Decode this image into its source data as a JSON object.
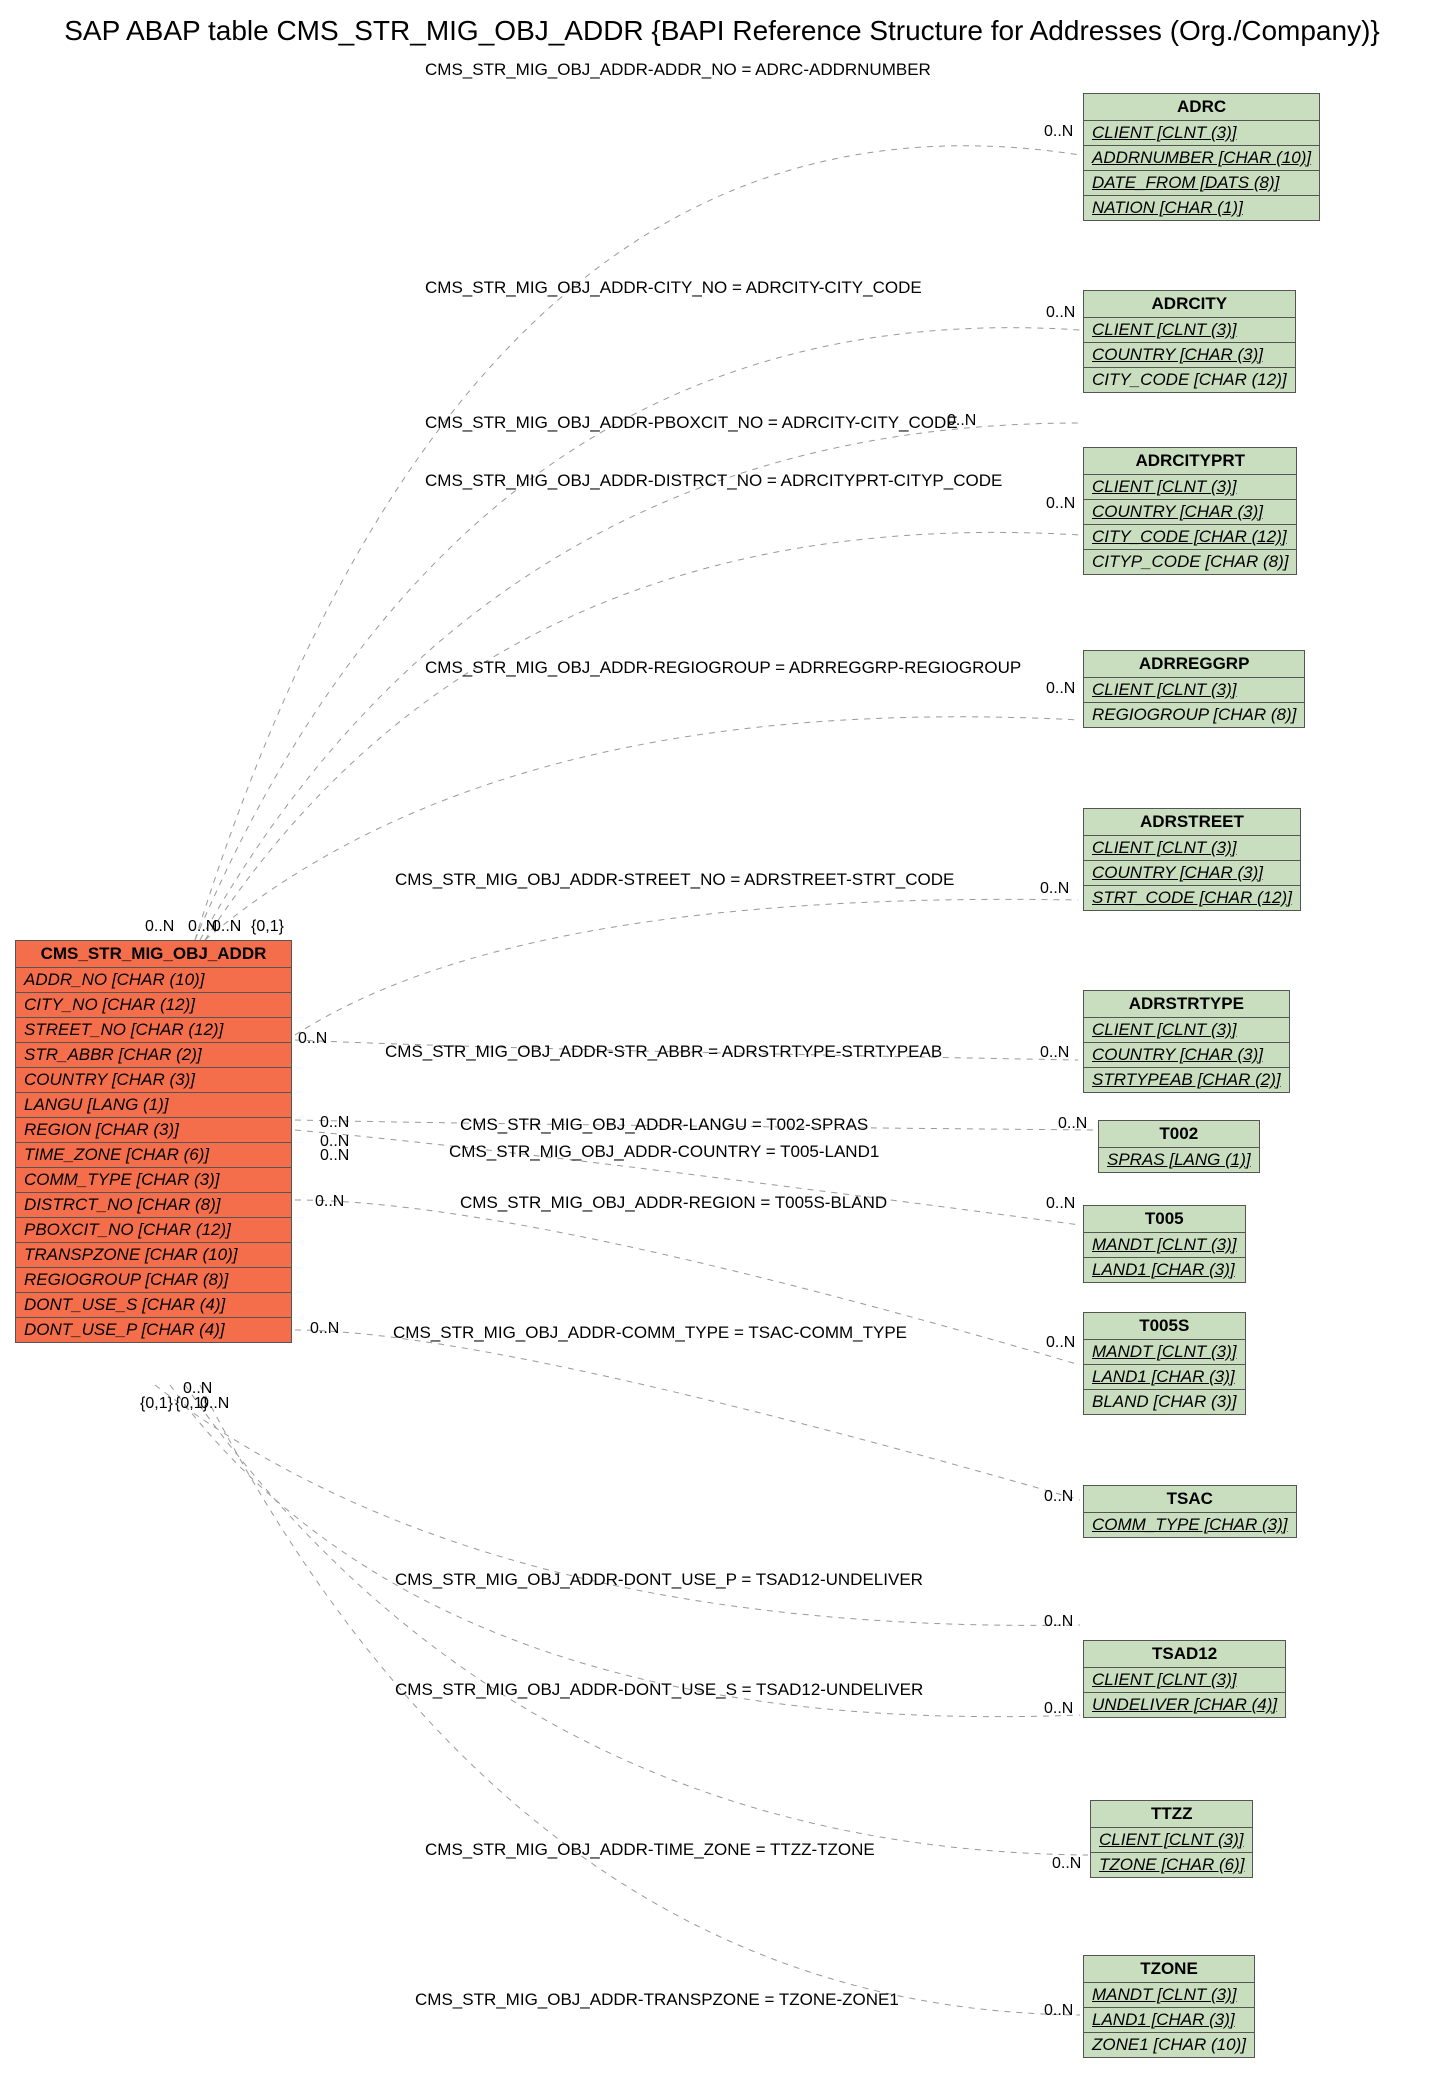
{
  "title": "SAP ABAP table CMS_STR_MIG_OBJ_ADDR {BAPI Reference Structure for Addresses (Org./Company)}",
  "main": {
    "name": "CMS_STR_MIG_OBJ_ADDR",
    "fields": [
      "ADDR_NO [CHAR (10)]",
      "CITY_NO [CHAR (12)]",
      "STREET_NO [CHAR (12)]",
      "STR_ABBR [CHAR (2)]",
      "COUNTRY [CHAR (3)]",
      "LANGU [LANG (1)]",
      "REGION [CHAR (3)]",
      "TIME_ZONE [CHAR (6)]",
      "COMM_TYPE [CHAR (3)]",
      "DISTRCT_NO [CHAR (8)]",
      "PBOXCIT_NO [CHAR (12)]",
      "TRANSPZONE [CHAR (10)]",
      "REGIOGROUP [CHAR (8)]",
      "DONT_USE_S [CHAR (4)]",
      "DONT_USE_P [CHAR (4)]"
    ]
  },
  "refs": [
    {
      "name": "ADRC",
      "fields": [
        {
          "t": "CLIENT [CLNT (3)]",
          "u": 1
        },
        {
          "t": "ADDRNUMBER [CHAR (10)]",
          "u": 1
        },
        {
          "t": "DATE_FROM [DATS (8)]",
          "u": 1
        },
        {
          "t": "NATION [CHAR (1)]",
          "u": 1
        }
      ]
    },
    {
      "name": "ADRCITY",
      "fields": [
        {
          "t": "CLIENT [CLNT (3)]",
          "u": 1
        },
        {
          "t": "COUNTRY [CHAR (3)]",
          "u": 1
        },
        {
          "t": "CITY_CODE [CHAR (12)]",
          "u": 0
        }
      ]
    },
    {
      "name": "ADRCITYPRT",
      "fields": [
        {
          "t": "CLIENT [CLNT (3)]",
          "u": 1
        },
        {
          "t": "COUNTRY [CHAR (3)]",
          "u": 1
        },
        {
          "t": "CITY_CODE [CHAR (12)]",
          "u": 1
        },
        {
          "t": "CITYP_CODE [CHAR (8)]",
          "u": 0
        }
      ]
    },
    {
      "name": "ADRREGGRP",
      "fields": [
        {
          "t": "CLIENT [CLNT (3)]",
          "u": 1
        },
        {
          "t": "REGIOGROUP [CHAR (8)]",
          "u": 0
        }
      ]
    },
    {
      "name": "ADRSTREET",
      "fields": [
        {
          "t": "CLIENT [CLNT (3)]",
          "u": 1
        },
        {
          "t": "COUNTRY [CHAR (3)]",
          "u": 1
        },
        {
          "t": "STRT_CODE [CHAR (12)]",
          "u": 1
        }
      ]
    },
    {
      "name": "ADRSTRTYPE",
      "fields": [
        {
          "t": "CLIENT [CLNT (3)]",
          "u": 1
        },
        {
          "t": "COUNTRY [CHAR (3)]",
          "u": 1
        },
        {
          "t": "STRTYPEAB [CHAR (2)]",
          "u": 1
        }
      ]
    },
    {
      "name": "T002",
      "fields": [
        {
          "t": "SPRAS [LANG (1)]",
          "u": 1
        }
      ]
    },
    {
      "name": "T005",
      "fields": [
        {
          "t": "MANDT [CLNT (3)]",
          "u": 1
        },
        {
          "t": "LAND1 [CHAR (3)]",
          "u": 1
        }
      ]
    },
    {
      "name": "T005S",
      "fields": [
        {
          "t": "MANDT [CLNT (3)]",
          "u": 1
        },
        {
          "t": "LAND1 [CHAR (3)]",
          "u": 1
        },
        {
          "t": "BLAND [CHAR (3)]",
          "u": 0
        }
      ]
    },
    {
      "name": "TSAC",
      "fields": [
        {
          "t": "COMM_TYPE [CHAR (3)]",
          "u": 1
        }
      ]
    },
    {
      "name": "TSAD12",
      "fields": [
        {
          "t": "CLIENT [CLNT (3)]",
          "u": 1
        },
        {
          "t": "UNDELIVER [CHAR (4)]",
          "u": 1
        }
      ]
    },
    {
      "name": "TTZZ",
      "fields": [
        {
          "t": "CLIENT [CLNT (3)]",
          "u": 1
        },
        {
          "t": "TZONE [CHAR (6)]",
          "u": 1
        }
      ]
    },
    {
      "name": "TZONE",
      "fields": [
        {
          "t": "MANDT [CLNT (3)]",
          "u": 1
        },
        {
          "t": "LAND1 [CHAR (3)]",
          "u": 1
        },
        {
          "t": "ZONE1 [CHAR (10)]",
          "u": 0
        }
      ]
    }
  ],
  "rel": [
    "CMS_STR_MIG_OBJ_ADDR-ADDR_NO = ADRC-ADDRNUMBER",
    "CMS_STR_MIG_OBJ_ADDR-CITY_NO = ADRCITY-CITY_CODE",
    "CMS_STR_MIG_OBJ_ADDR-PBOXCIT_NO = ADRCITY-CITY_CODE",
    "CMS_STR_MIG_OBJ_ADDR-DISTRCT_NO = ADRCITYPRT-CITYP_CODE",
    "CMS_STR_MIG_OBJ_ADDR-REGIOGROUP = ADRREGGRP-REGIOGROUP",
    "CMS_STR_MIG_OBJ_ADDR-STREET_NO = ADRSTREET-STRT_CODE",
    "CMS_STR_MIG_OBJ_ADDR-STR_ABBR = ADRSTRTYPE-STRTYPEAB",
    "CMS_STR_MIG_OBJ_ADDR-LANGU = T002-SPRAS",
    "CMS_STR_MIG_OBJ_ADDR-COUNTRY = T005-LAND1",
    "CMS_STR_MIG_OBJ_ADDR-REGION = T005S-BLAND",
    "CMS_STR_MIG_OBJ_ADDR-COMM_TYPE = TSAC-COMM_TYPE",
    "CMS_STR_MIG_OBJ_ADDR-DONT_USE_P = TSAD12-UNDELIVER",
    "CMS_STR_MIG_OBJ_ADDR-DONT_USE_S = TSAD12-UNDELIVER",
    "CMS_STR_MIG_OBJ_ADDR-TIME_ZONE = TTZZ-TZONE",
    "CMS_STR_MIG_OBJ_ADDR-TRANSPZONE = TZONE-ZONE1"
  ],
  "card": {
    "left": "0..N",
    "right": "0..N",
    "braces": [
      "{0,1}",
      "{0,1}",
      "{0,1}",
      "0..N",
      "0..N",
      "0..N",
      "0..N"
    ]
  }
}
